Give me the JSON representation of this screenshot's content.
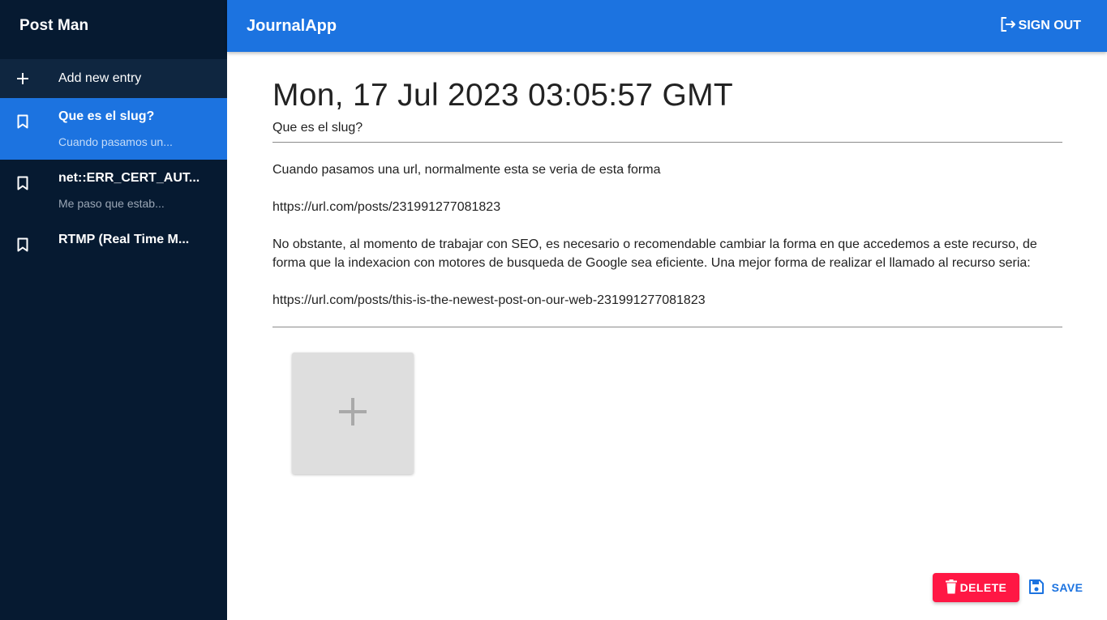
{
  "sidebar": {
    "title": "Post Man",
    "add_entry_label": "Add new entry",
    "entries": [
      {
        "title": "Que es el slug?",
        "subtitle": "Cuando pasamos un...",
        "active": true
      },
      {
        "title": "net::ERR_CERT_AUT...",
        "subtitle": "Me paso que estab...",
        "active": false
      },
      {
        "title": "RTMP (Real Time M...",
        "subtitle": "",
        "active": false
      }
    ]
  },
  "appbar": {
    "brand": "JournalApp",
    "signout_label": "SIGN OUT"
  },
  "note": {
    "date": "Mon, 17 Jul 2023 03:05:57 GMT",
    "title": "Que es el slug?",
    "body": [
      "Cuando pasamos una url, normalmente esta se veria de esta forma",
      "https://url.com/posts/231991277081823",
      "No obstante, al momento de trabajar con SEO, es necesario o recomendable cambiar la forma en que accedemos a este recurso, de forma que la indexacion con motores de busqueda de Google sea eficiente. Una mejor forma de realizar el llamado al recurso seria:",
      "https://url.com/posts/this-is-the-newest-post-on-our-web-231991277081823"
    ]
  },
  "actions": {
    "delete_label": "DELETE",
    "save_label": "SAVE"
  },
  "colors": {
    "sidebar_bg": "#061a31",
    "accent": "#1c73e0",
    "danger": "#ff1744"
  }
}
